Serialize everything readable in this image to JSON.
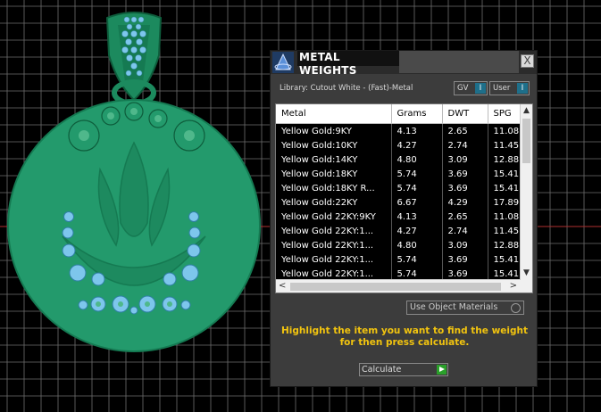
{
  "panel": {
    "title": "METAL WEIGHTS",
    "close_label": "X",
    "library_label": "Library: Cutout White - (Fast)-Metal",
    "toggle_gv_label": "GV",
    "toggle_user_label": "User",
    "toggle_indicator": "I",
    "columns": [
      "Metal",
      "Grams",
      "DWT",
      "SPG"
    ],
    "rows": [
      [
        "Yellow Gold:9KY",
        "4.13",
        "2.65",
        "11.08"
      ],
      [
        "Yellow Gold:10KY",
        "4.27",
        "2.74",
        "11.45"
      ],
      [
        "Yellow Gold:14KY",
        "4.80",
        "3.09",
        "12.88"
      ],
      [
        "Yellow Gold:18KY",
        "5.74",
        "3.69",
        "15.41"
      ],
      [
        "Yellow Gold:18KY R...",
        "5.74",
        "3.69",
        "15.41"
      ],
      [
        "Yellow Gold:22KY",
        "6.67",
        "4.29",
        "17.89"
      ],
      [
        "Yellow Gold 22KY:9KY",
        "4.13",
        "2.65",
        "11.08"
      ],
      [
        "Yellow Gold 22KY:1...",
        "4.27",
        "2.74",
        "11.45"
      ],
      [
        "Yellow Gold 22KY:1...",
        "4.80",
        "3.09",
        "12.88"
      ],
      [
        "Yellow Gold 22KY:1...",
        "5.74",
        "3.69",
        "15.41"
      ],
      [
        "Yellow Gold 22KY:1...",
        "5.74",
        "3.69",
        "15.41"
      ]
    ],
    "use_object_materials_label": "Use Object Materials",
    "hint": "Highlight the item you want to find the weight for then press calculate.",
    "calculate_label": "Calculate"
  },
  "icons": {
    "app": "app-logo-icon",
    "close": "close-icon",
    "scroll_up": "chevron-up-icon",
    "scroll_down": "chevron-down-icon",
    "scroll_left": "chevron-left-icon",
    "scroll_right": "chevron-right-icon",
    "calculate": "play-icon"
  },
  "colors": {
    "viewport_bg": "#000000",
    "grid": "#6e6e6e",
    "pendant": "#239a6c",
    "pendant_dark": "#157a52",
    "gem": "#7dc6ec",
    "hint_text": "#f2c40f",
    "panel_bg": "#3c3c3c"
  }
}
